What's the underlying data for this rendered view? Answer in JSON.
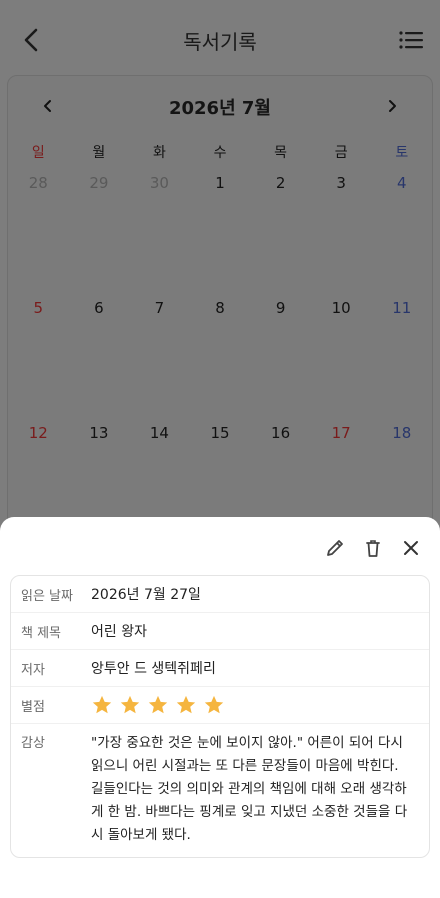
{
  "header": {
    "title": "독서기록"
  },
  "calendar": {
    "title": "2026년 7월",
    "weekdays": [
      "일",
      "월",
      "화",
      "수",
      "목",
      "금",
      "토"
    ],
    "weeks": [
      [
        "28",
        "29",
        "30",
        "1",
        "2",
        "3",
        "4"
      ],
      [
        "5",
        "6",
        "7",
        "8",
        "9",
        "10",
        "11"
      ],
      [
        "12",
        "13",
        "14",
        "15",
        "16",
        "17",
        "18"
      ]
    ]
  },
  "detail": {
    "date_label": "읽은 날짜",
    "date_value": "2026년 7월 27일",
    "title_label": "책 제목",
    "title_value": "어린 왕자",
    "author_label": "저자",
    "author_value": "앙투안 드 생텍쥐페리",
    "rating_label": "별점",
    "rating_value": 5,
    "rating_max": 5,
    "review_label": "감상",
    "review_value": "\"가장 중요한 것은 눈에 보이지 않아.\" 어른이 되어 다시 읽으니 어린 시절과는 또 다른 문장들이 마음에 박힌다. 길들인다는 것의 의미와 관계의 책임에 대해 오래 생각하게 한 밤. 바쁘다는 핑계로 잊고 지냈던 소중한 것들을 다시 돌아보게 됐다."
  },
  "colors": {
    "star": "#f5b53f",
    "sunday": "#c0392b",
    "saturday": "#3a4d8f"
  },
  "icons": [
    "back-arrow-icon",
    "list-menu-icon",
    "chevron-left-icon",
    "chevron-right-icon",
    "edit-pencil-icon",
    "trash-icon",
    "close-icon",
    "star-icon"
  ]
}
